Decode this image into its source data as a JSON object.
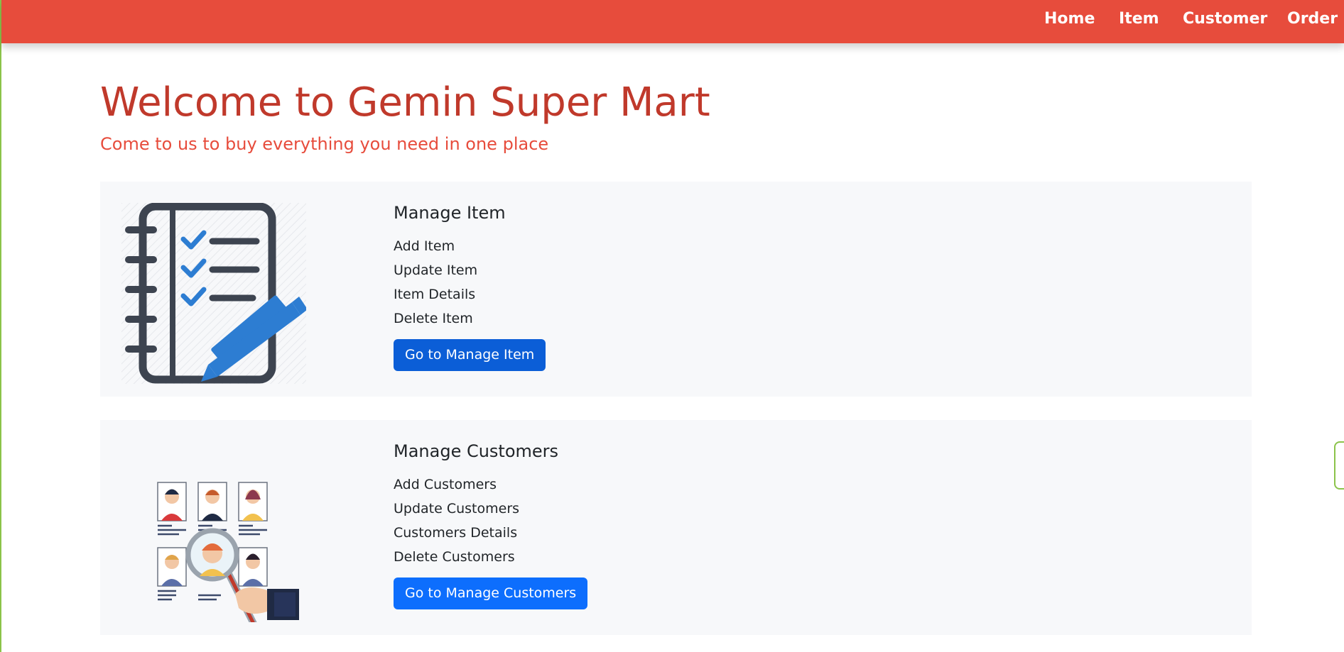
{
  "nav": {
    "links": [
      "Home",
      "Item",
      "Customer",
      "Order"
    ]
  },
  "hero": {
    "title": "Welcome to Gemin Super Mart",
    "subtitle": "Come to us to buy everything you need in one place"
  },
  "cards": [
    {
      "heading": "Manage Item",
      "features": [
        "Add Item",
        "Update Item",
        "Item Details",
        "Delete Item"
      ],
      "button": "Go to Manage Item",
      "icon": "checklist-notebook-icon"
    },
    {
      "heading": "Manage Customers",
      "features": [
        "Add Customers",
        "Update Customers",
        "Customers Details",
        "Delete Customers"
      ],
      "button": "Go to Manage Customers",
      "icon": "customer-search-icon"
    }
  ],
  "colors": {
    "navbar": "#e74c3c",
    "title": "#c0392b",
    "button": "#0d6efd",
    "card_bg": "#f7f8fa"
  }
}
